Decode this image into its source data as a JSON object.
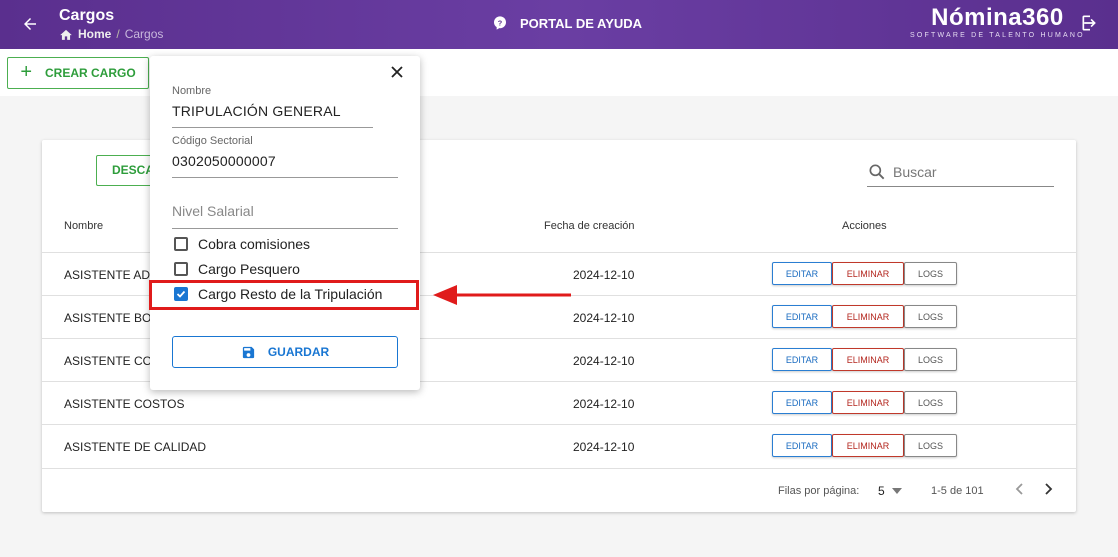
{
  "header": {
    "title": "Cargos",
    "breadcrumb": {
      "home": "Home",
      "current": "Cargos"
    },
    "help_label": "PORTAL DE AYUDA",
    "brand_name": "Nómina360",
    "brand_tagline": "SOFTWARE DE TALENTO HUMANO"
  },
  "toolbar": {
    "create_label": "CREAR CARGO"
  },
  "table": {
    "download_label": "DESCA",
    "search_placeholder": "Buscar",
    "columns": {
      "name": "Nombre",
      "date": "Fecha de creación",
      "actions": "Acciones"
    },
    "rows": [
      {
        "name": "ASISTENTE ADM",
        "date": "2024-12-10"
      },
      {
        "name": "ASISTENTE BOD",
        "date": "2024-12-10"
      },
      {
        "name": "ASISTENTE CON",
        "date": "2024-12-10"
      },
      {
        "name": "ASISTENTE COSTOS",
        "date": "2024-12-10"
      },
      {
        "name": "ASISTENTE DE CALIDAD",
        "date": "2024-12-10"
      }
    ],
    "actions": {
      "edit": "EDITAR",
      "delete": "ELIMINAR",
      "logs": "LOGS"
    },
    "footer": {
      "rows_per_page_label": "Filas por página:",
      "rows_per_page": "5",
      "range": "1-5 de 101"
    }
  },
  "form": {
    "name_label": "Nombre",
    "name_value": "TRIPULACIÓN GENERAL",
    "code_label": "Código Sectorial",
    "code_value": "0302050000007",
    "salary_placeholder": "Nivel Salarial",
    "checkboxes": [
      {
        "label": "Cobra comisiones",
        "checked": false
      },
      {
        "label": "Cargo Pesquero",
        "checked": false
      },
      {
        "label": "Cargo Resto de la Tripulación",
        "checked": true
      }
    ],
    "save_label": "GUARDAR"
  },
  "colors": {
    "header": "#5a2f8e",
    "primary": "#1976d2",
    "success": "#4caf50",
    "danger": "#c0392b",
    "annotation": "#e01b1b"
  }
}
